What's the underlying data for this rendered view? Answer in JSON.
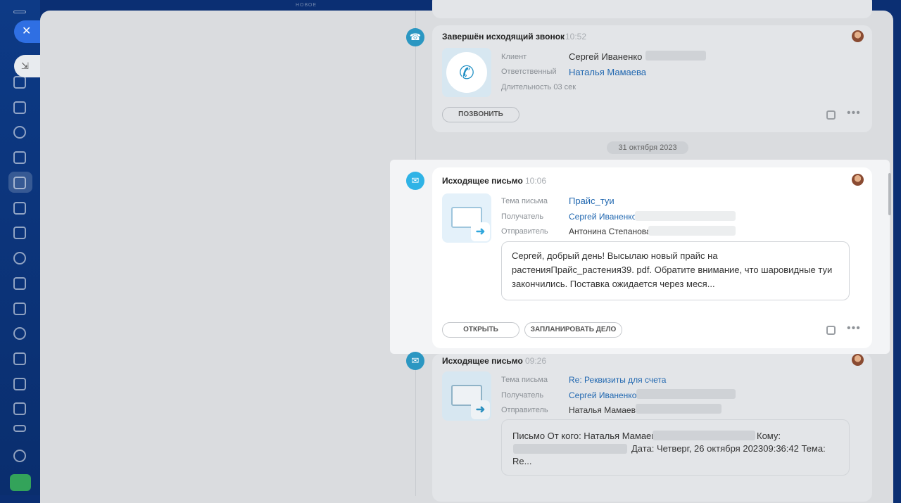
{
  "header": {
    "top_hint": "НОВОЕ"
  },
  "nav": {
    "close_glyph": "✕",
    "collapse_glyph": "⇲"
  },
  "call_card": {
    "title": "Завершён исходящий звонок",
    "time": "10:52",
    "client_label": "Клиент",
    "client_value": "Сергей Иваненко",
    "responsible_label": "Ответственный",
    "responsible_value": "Наталья Мамаева",
    "duration": "Длительность 03 сек",
    "call_button": "ПОЗВОНИТЬ"
  },
  "date_separator": "31 октября 2023",
  "email_card_1": {
    "title": "Исходящее письмо",
    "time": "10:06",
    "subject_label": "Тема письма",
    "subject_value": "Прайс_туи",
    "recipient_label": "Получатель",
    "recipient_value": "Сергей Иваненко",
    "sender_label": "Отправитель",
    "sender_value": "Антонина Степанова",
    "body": "Сергей, добрый день! Высылаю новый прайс на растенияПрайс_растения39. pdf. Обратите внимание, что шаровидные туи закончились. Поставка ожидается через меся...",
    "open_button": "ОТКРЫТЬ",
    "plan_button": "ЗАПЛАНИРОВАТЬ ДЕЛО"
  },
  "email_card_2": {
    "title": "Исходящее письмо",
    "time": "09:26",
    "subject_label": "Тема письма",
    "subject_value": "Re: Реквизиты для счета",
    "recipient_label": "Получатель",
    "recipient_value": "Сергей Иваненко",
    "sender_label": "Отправитель",
    "sender_value": "Наталья Мамаева",
    "body_line1": "Письмо От кого: Наталья Мамаева",
    "body_line1_end": "Кому:",
    "body_line2": "Дата: Четверг, 26 октября 202309:36:42 Тема:",
    "body_line3": "Re..."
  },
  "icons": {
    "phone": "phone-icon",
    "mail": "mail-icon",
    "note": "note-icon",
    "more": "more-icon"
  },
  "colors": {
    "accent": "#2fb3e6",
    "link": "#2067b0",
    "nav_bg": "#0b2f73"
  }
}
